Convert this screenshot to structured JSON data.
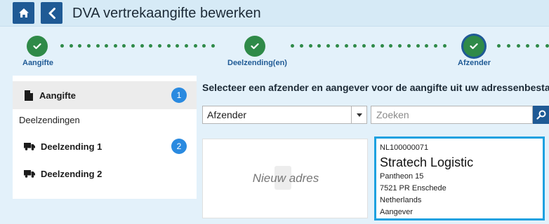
{
  "header": {
    "title": "DVA vertrekaangifte bewerken",
    "home_icon": "home-icon",
    "back_icon": "chevron-left-icon"
  },
  "stepper": {
    "steps": [
      {
        "label": "Aangifte",
        "state": "done"
      },
      {
        "label": "Deelzending(en)",
        "state": "done"
      },
      {
        "label": "Afzender",
        "state": "current"
      }
    ]
  },
  "sidebar": {
    "items": [
      {
        "label": "Aangifte",
        "badge": "1",
        "icon": "document-icon"
      }
    ],
    "section_title": "Deelzendingen",
    "sub_items": [
      {
        "label": "Deelzending 1",
        "badge": "2",
        "icon": "truck-icon"
      },
      {
        "label": "Deelzending 2",
        "icon": "truck-icon"
      }
    ]
  },
  "main": {
    "instruction": "Selecteer een afzender en aangever voor de aangifte uit uw adressenbestand",
    "type_select": {
      "value": "Afzender"
    },
    "search": {
      "placeholder": "Zoeken"
    },
    "new_address_label": "Nieuw adres",
    "address_card": {
      "code": "NL100000071",
      "name": "Stratech Logistic",
      "street": "Pantheon 15",
      "city": "7521 PR Enschede",
      "country": "Netherlands",
      "role": "Aangever"
    }
  },
  "colors": {
    "header_button": "#1f5a95",
    "step_done": "#2f8a48",
    "badge": "#2a8ae0",
    "selected_border": "#1da1e0"
  }
}
